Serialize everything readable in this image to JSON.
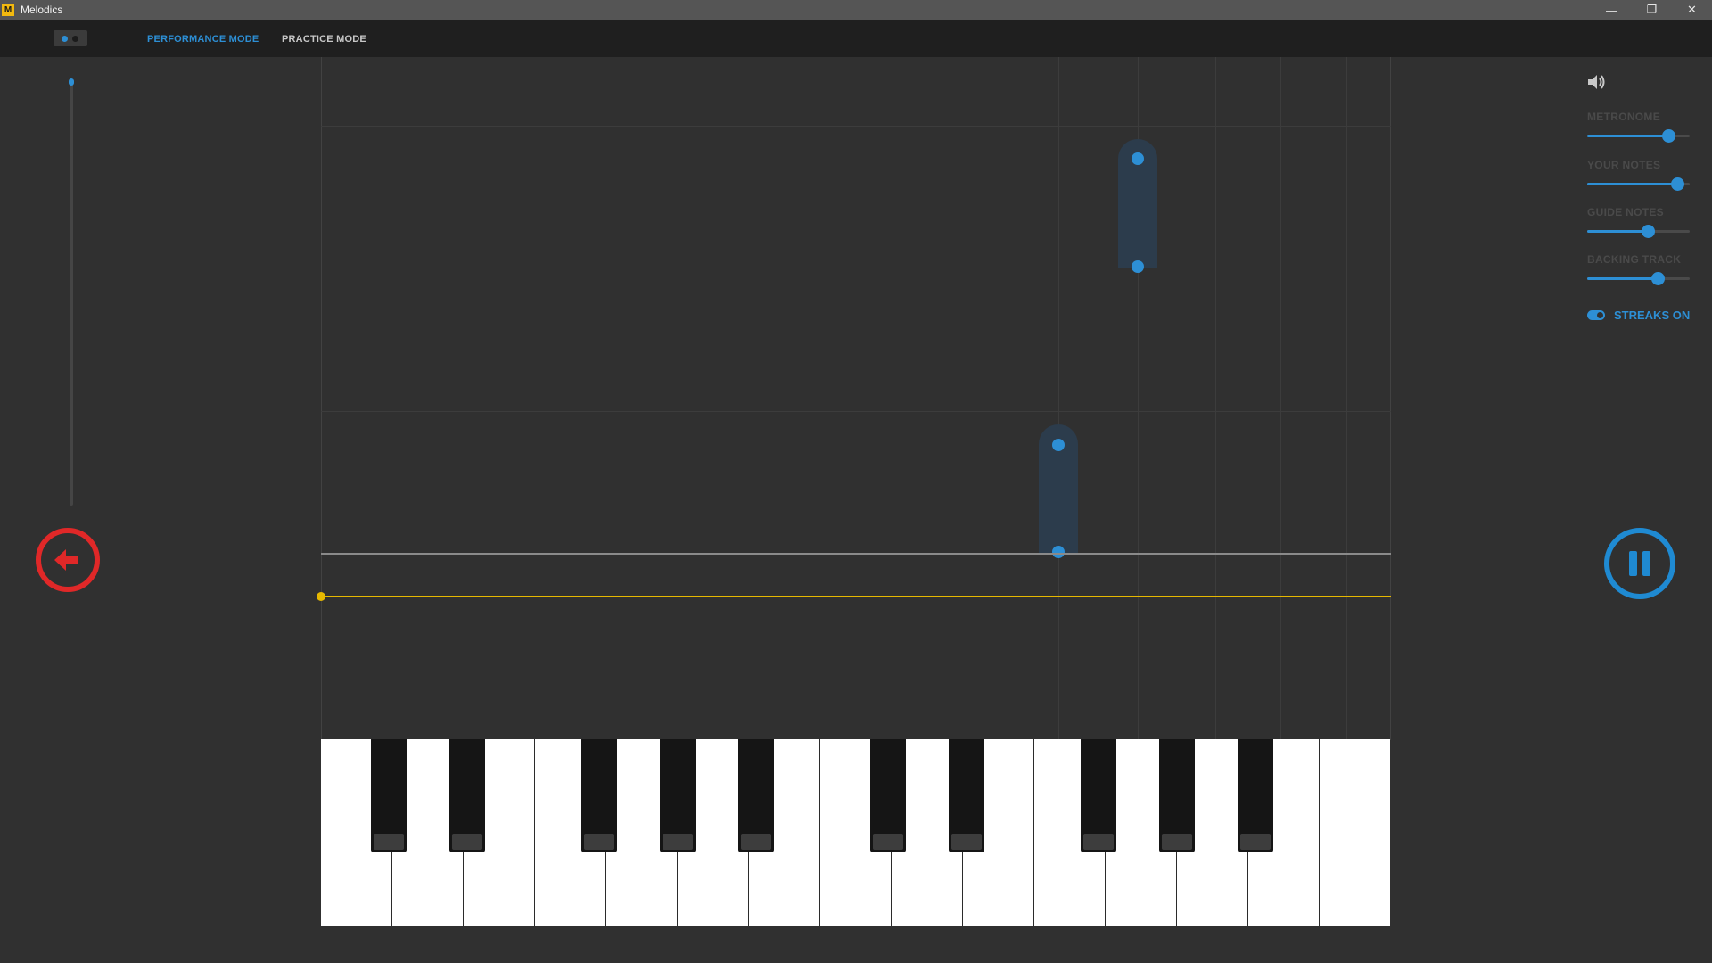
{
  "window": {
    "title": "Melodics",
    "logo_letter": "M",
    "minimize_glyph": "—",
    "restore_glyph": "❐",
    "close_glyph": "✕"
  },
  "tabs": [
    {
      "label": "PERFORMANCE MODE",
      "active": true
    },
    {
      "label": "PRACTICE MODE",
      "active": false
    }
  ],
  "volume_panel": {
    "sliders": [
      {
        "label": "METRONOME",
        "value": 0.79
      },
      {
        "label": "YOUR NOTES",
        "value": 0.88
      },
      {
        "label": "GUIDE NOTES",
        "value": 0.59
      },
      {
        "label": "BACKING TRACK",
        "value": 0.69
      }
    ],
    "streaks_label": "STREAKS ON",
    "streaks_on": true
  },
  "colors": {
    "accent": "#2d8fd5",
    "back_button": "#e02828",
    "playhead": "#e6b800",
    "background": "#303030"
  },
  "icons": [
    "app-logo-icon",
    "speaker-icon",
    "back-arrow-icon",
    "pause-icon"
  ]
}
